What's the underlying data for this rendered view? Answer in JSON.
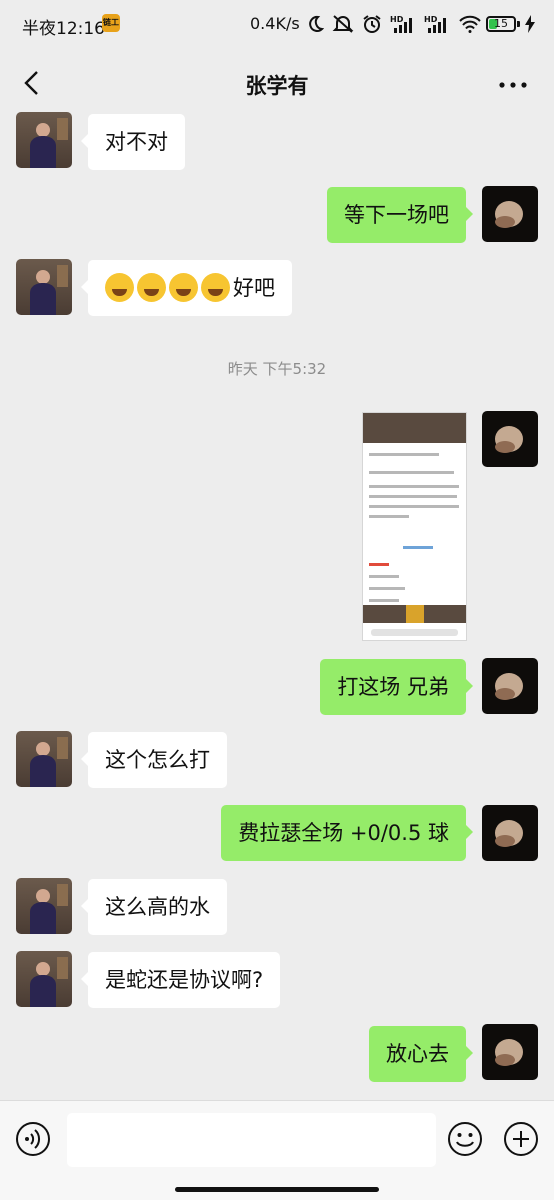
{
  "status_bar": {
    "time": "半夜12:16",
    "app_badge": "链工",
    "network_speed": "0.4K/s",
    "icons": [
      "moon-icon",
      "mute-icon",
      "alarm-icon",
      "hd-signal-icon",
      "hd-signal-icon",
      "wifi-icon"
    ],
    "battery": "15",
    "battery_level_percent": 15,
    "battery_color": "#33c24d"
  },
  "nav": {
    "back_icon": "back-arrow-icon",
    "title": "张学有",
    "more_icon": "more-dots-icon"
  },
  "messages": [
    {
      "side": "left",
      "type": "text",
      "text": "对不对"
    },
    {
      "side": "right",
      "type": "text",
      "text": "等下一场吧"
    },
    {
      "side": "left",
      "type": "text_emoji",
      "emoji_count": 4,
      "emoji": "tears-of-joy-emoji",
      "text": "好吧"
    },
    {
      "type": "timestamp",
      "text": "昨天 下午5:32"
    },
    {
      "side": "right",
      "type": "image",
      "description_icon": "screenshot-thumbnail"
    },
    {
      "side": "right",
      "type": "text",
      "text": "打这场 兄弟"
    },
    {
      "side": "left",
      "type": "text",
      "text": "这个怎么打"
    },
    {
      "side": "right",
      "type": "text",
      "text": "费拉瑟全场 +0/0.5 球"
    },
    {
      "side": "left",
      "type": "text",
      "text": "这么高的水"
    },
    {
      "side": "left",
      "type": "text",
      "text": "是蛇还是协议啊?"
    },
    {
      "side": "right",
      "type": "text",
      "text": "放心去"
    }
  ],
  "input_bar": {
    "voice_icon": "voice-icon",
    "input_value": "",
    "emoji_icon": "emoji-icon",
    "plus_icon": "plus-icon"
  },
  "colors": {
    "background": "#ededed",
    "bubble_self": "#95ec69",
    "bubble_other": "#ffffff",
    "timestamp": "#8c8c8c"
  }
}
